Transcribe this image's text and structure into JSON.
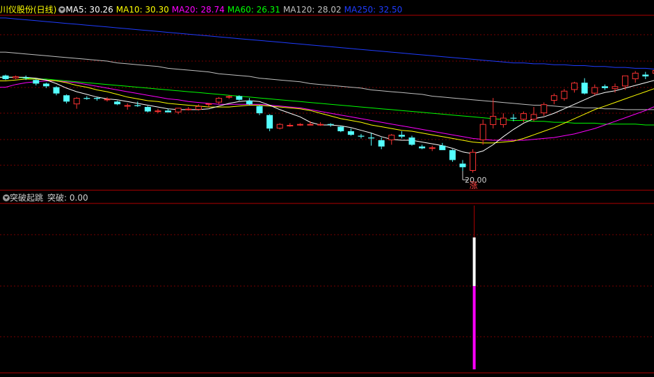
{
  "main_panel": {
    "title": "川仪股份(日线)",
    "ma_labels": [
      {
        "text": "MA5: 30.26",
        "color": "#ffffff"
      },
      {
        "text": "MA10: 30.30",
        "color": "#ffff00"
      },
      {
        "text": "MA20: 28.74",
        "color": "#ff00ff"
      },
      {
        "text": "MA60: 26.31",
        "color": "#00ff00"
      },
      {
        "text": "MA120: 28.02",
        "color": "#c0c0c0"
      },
      {
        "text": "MA250: 32.50",
        "color": "#1f3cff"
      }
    ],
    "low_label": "20.00",
    "signal_char": "涨"
  },
  "indicator_panel": {
    "title": "突破起跳",
    "value_label": "突破: 0.00"
  },
  "colors": {
    "background": "#000000",
    "up_candle": "#ff3333",
    "down_candle": "#54ffff",
    "grid": "#7a0000",
    "separator": "#b00000",
    "ma5": "#ffffff",
    "ma10": "#ffff00",
    "ma20": "#ff00ff",
    "ma60": "#00ff00",
    "ma120": "#c0c0c0",
    "ma250": "#1f3cff",
    "signal_bar_top": "#ffffff",
    "signal_bar_bottom": "#ff00ff"
  },
  "chart_data": {
    "type": "candlestick",
    "candles": [
      [
        31.8,
        31.9,
        31.3,
        31.4
      ],
      [
        31.5,
        31.8,
        31.4,
        31.7
      ],
      [
        31.6,
        31.8,
        31.3,
        31.5
      ],
      [
        31.3,
        31.4,
        30.7,
        30.9
      ],
      [
        30.9,
        31.0,
        30.4,
        30.6
      ],
      [
        30.5,
        30.6,
        29.6,
        29.8
      ],
      [
        29.6,
        29.7,
        28.7,
        28.9
      ],
      [
        28.6,
        29.4,
        28.1,
        29.3
      ],
      [
        29.3,
        29.5,
        29.1,
        29.2
      ],
      [
        29.3,
        29.4,
        29.0,
        29.2
      ],
      [
        29.2,
        29.4,
        28.9,
        29.2
      ],
      [
        28.9,
        29.0,
        28.5,
        28.6
      ],
      [
        28.5,
        28.7,
        28.0,
        28.5
      ],
      [
        28.5,
        28.9,
        28.3,
        28.4
      ],
      [
        28.3,
        28.4,
        27.7,
        27.8
      ],
      [
        27.8,
        28.1,
        27.6,
        27.9
      ],
      [
        27.9,
        28.1,
        27.7,
        27.7
      ],
      [
        27.7,
        28.1,
        27.5,
        28.2
      ],
      [
        28.1,
        28.3,
        27.9,
        28.1
      ],
      [
        28.0,
        28.6,
        27.9,
        28.4
      ],
      [
        28.6,
        28.7,
        28.3,
        28.7
      ],
      [
        28.8,
        29.4,
        28.6,
        29.3
      ],
      [
        29.4,
        29.6,
        29.2,
        29.5
      ],
      [
        29.5,
        29.6,
        29.0,
        29.1
      ],
      [
        29.0,
        29.3,
        28.5,
        28.6
      ],
      [
        28.4,
        28.5,
        27.4,
        27.6
      ],
      [
        27.4,
        27.5,
        25.6,
        25.9
      ],
      [
        25.9,
        26.5,
        25.8,
        26.4
      ],
      [
        26.3,
        26.5,
        26.1,
        26.3
      ],
      [
        26.3,
        26.5,
        26.2,
        26.4
      ],
      [
        26.4,
        26.7,
        26.3,
        26.4
      ],
      [
        26.4,
        26.6,
        26.2,
        26.4
      ],
      [
        26.4,
        26.5,
        26.1,
        26.3
      ],
      [
        26.1,
        26.2,
        25.5,
        25.6
      ],
      [
        25.6,
        25.9,
        25.1,
        25.2
      ],
      [
        25.1,
        25.3,
        24.8,
        25.0
      ],
      [
        24.9,
        25.4,
        24.0,
        24.8
      ],
      [
        24.6,
        24.9,
        23.6,
        23.9
      ],
      [
        24.6,
        25.3,
        24.1,
        25.2
      ],
      [
        25.2,
        25.6,
        24.8,
        25.0
      ],
      [
        24.9,
        25.1,
        24.0,
        24.1
      ],
      [
        23.9,
        24.1,
        23.6,
        23.7
      ],
      [
        23.7,
        24.0,
        23.4,
        23.8
      ],
      [
        24.0,
        24.3,
        23.5,
        23.5
      ],
      [
        23.5,
        23.6,
        22.2,
        22.4
      ],
      [
        22.0,
        22.4,
        21.2,
        21.6
      ],
      [
        21.2,
        23.6,
        21.0,
        23.3
      ],
      [
        24.6,
        26.9,
        24.1,
        26.4
      ],
      [
        26.3,
        29.3,
        25.9,
        27.3
      ],
      [
        26.3,
        27.6,
        26.0,
        27.1
      ],
      [
        27.1,
        27.5,
        26.7,
        27.0
      ],
      [
        26.9,
        27.8,
        26.6,
        27.6
      ],
      [
        26.9,
        28.3,
        26.7,
        27.5
      ],
      [
        27.6,
        28.8,
        27.3,
        28.6
      ],
      [
        29.0,
        29.8,
        28.6,
        29.6
      ],
      [
        29.2,
        30.3,
        29.0,
        30.1
      ],
      [
        30.2,
        31.1,
        29.9,
        31.0
      ],
      [
        31.0,
        31.5,
        29.7,
        29.8
      ],
      [
        29.8,
        30.8,
        29.6,
        30.5
      ],
      [
        30.6,
        30.8,
        30.2,
        30.4
      ],
      [
        30.3,
        30.9,
        29.9,
        30.6
      ],
      [
        30.6,
        31.8,
        30.2,
        31.8
      ],
      [
        31.4,
        32.3,
        31.0,
        32.1
      ],
      [
        31.9,
        32.2,
        31.4,
        31.7
      ],
      [
        32.0,
        32.5,
        31.6,
        32.4
      ]
    ],
    "ma": {
      "ma5": [
        31.6,
        31.6,
        31.6,
        31.5,
        31.3,
        30.9,
        30.4,
        30.0,
        29.7,
        29.4,
        29.2,
        29.1,
        28.9,
        28.7,
        28.5,
        28.3,
        28.1,
        28.0,
        28.0,
        28.0,
        28.1,
        28.4,
        28.7,
        28.9,
        29.0,
        28.9,
        28.5,
        28.0,
        27.6,
        27.2,
        26.6,
        26.3,
        26.3,
        26.2,
        26.0,
        25.7,
        25.4,
        25.0,
        24.7,
        24.6,
        24.6,
        24.4,
        24.2,
        24.0,
        23.7,
        23.3,
        23.1,
        23.4,
        24.1,
        25.0,
        25.8,
        26.5,
        27.0,
        27.2,
        27.6,
        28.1,
        28.6,
        29.1,
        29.6,
        29.9,
        30.1,
        30.4,
        30.7,
        31.0,
        31.3
      ],
      "ma10": [
        31.2,
        31.3,
        31.4,
        31.4,
        31.3,
        31.2,
        31.0,
        30.7,
        30.5,
        30.2,
        30.0,
        29.7,
        29.4,
        29.2,
        29.0,
        28.9,
        28.7,
        28.6,
        28.5,
        28.4,
        28.3,
        28.3,
        28.3,
        28.4,
        28.5,
        28.5,
        28.4,
        28.3,
        28.2,
        28.1,
        27.9,
        27.6,
        27.3,
        27.0,
        26.8,
        26.6,
        26.3,
        26.1,
        25.9,
        25.7,
        25.6,
        25.4,
        25.2,
        25.0,
        24.8,
        24.6,
        24.4,
        24.3,
        24.3,
        24.4,
        24.5,
        24.8,
        25.2,
        25.6,
        26.0,
        26.5,
        27.0,
        27.5,
        28.0,
        28.4,
        28.8,
        29.2,
        29.6,
        30.0,
        30.4
      ],
      "ma20": [
        30.5,
        30.8,
        31.0,
        31.1,
        31.2,
        31.2,
        31.1,
        31.0,
        30.8,
        30.6,
        30.4,
        30.2,
        30.0,
        29.8,
        29.6,
        29.4,
        29.2,
        29.1,
        28.9,
        28.8,
        28.7,
        28.6,
        28.6,
        28.6,
        28.6,
        28.6,
        28.5,
        28.4,
        28.3,
        28.2,
        28.0,
        27.8,
        27.6,
        27.4,
        27.2,
        27.0,
        26.8,
        26.6,
        26.4,
        26.2,
        26.0,
        25.8,
        25.6,
        25.4,
        25.2,
        25.0,
        24.8,
        24.7,
        24.6,
        24.6,
        24.6,
        24.6,
        24.7,
        24.8,
        24.9,
        25.1,
        25.3,
        25.6,
        25.9,
        26.3,
        26.7,
        27.1,
        27.5,
        27.9,
        28.4
      ],
      "ma60": [
        31.6,
        31.6,
        31.5,
        31.4,
        31.4,
        31.3,
        31.2,
        31.1,
        31.0,
        30.9,
        30.8,
        30.7,
        30.6,
        30.5,
        30.4,
        30.3,
        30.2,
        30.1,
        30.0,
        29.9,
        29.8,
        29.7,
        29.6,
        29.5,
        29.4,
        29.3,
        29.2,
        29.1,
        29.0,
        28.9,
        28.8,
        28.7,
        28.6,
        28.5,
        28.4,
        28.3,
        28.2,
        28.1,
        28.0,
        27.9,
        27.8,
        27.7,
        27.6,
        27.5,
        27.4,
        27.3,
        27.2,
        27.1,
        27.0,
        26.9,
        26.8,
        26.8,
        26.7,
        26.7,
        26.6,
        26.6,
        26.5,
        26.5,
        26.5,
        26.4,
        26.4,
        26.4,
        26.4,
        26.3,
        26.3
      ],
      "ma120": [
        34.4,
        34.3,
        34.2,
        34.1,
        34.0,
        33.9,
        33.8,
        33.7,
        33.6,
        33.5,
        33.4,
        33.2,
        33.1,
        33.0,
        32.9,
        32.8,
        32.6,
        32.5,
        32.4,
        32.3,
        32.2,
        32.0,
        31.9,
        31.8,
        31.7,
        31.5,
        31.4,
        31.3,
        31.2,
        31.1,
        30.9,
        30.8,
        30.7,
        30.6,
        30.5,
        30.4,
        30.2,
        30.1,
        30.0,
        29.9,
        29.8,
        29.7,
        29.5,
        29.4,
        29.3,
        29.2,
        29.1,
        29.0,
        28.9,
        28.8,
        28.7,
        28.6,
        28.5,
        28.5,
        28.4,
        28.3,
        28.3,
        28.2,
        28.2,
        28.1,
        28.1,
        28.0,
        28.0,
        28.0,
        28.0
      ],
      "ma250": [
        38.2,
        38.1,
        38.0,
        37.9,
        37.8,
        37.7,
        37.6,
        37.5,
        37.4,
        37.3,
        37.2,
        37.1,
        37.0,
        36.9,
        36.8,
        36.7,
        36.6,
        36.5,
        36.4,
        36.3,
        36.2,
        36.1,
        36.0,
        35.9,
        35.8,
        35.7,
        35.6,
        35.5,
        35.4,
        35.3,
        35.2,
        35.1,
        35.0,
        34.9,
        34.8,
        34.7,
        34.6,
        34.5,
        34.4,
        34.3,
        34.2,
        34.1,
        34.0,
        33.9,
        33.8,
        33.7,
        33.6,
        33.5,
        33.4,
        33.3,
        33.2,
        33.2,
        33.1,
        33.1,
        33.0,
        33.0,
        32.9,
        32.9,
        32.8,
        32.8,
        32.7,
        32.7,
        32.6,
        32.6,
        32.5
      ]
    },
    "low_marker": {
      "candle_index": 45,
      "value": 20.0
    },
    "signal": {
      "candle_index": 46,
      "text": "涨",
      "value": 1.0
    },
    "indicator_value": 0.0
  }
}
